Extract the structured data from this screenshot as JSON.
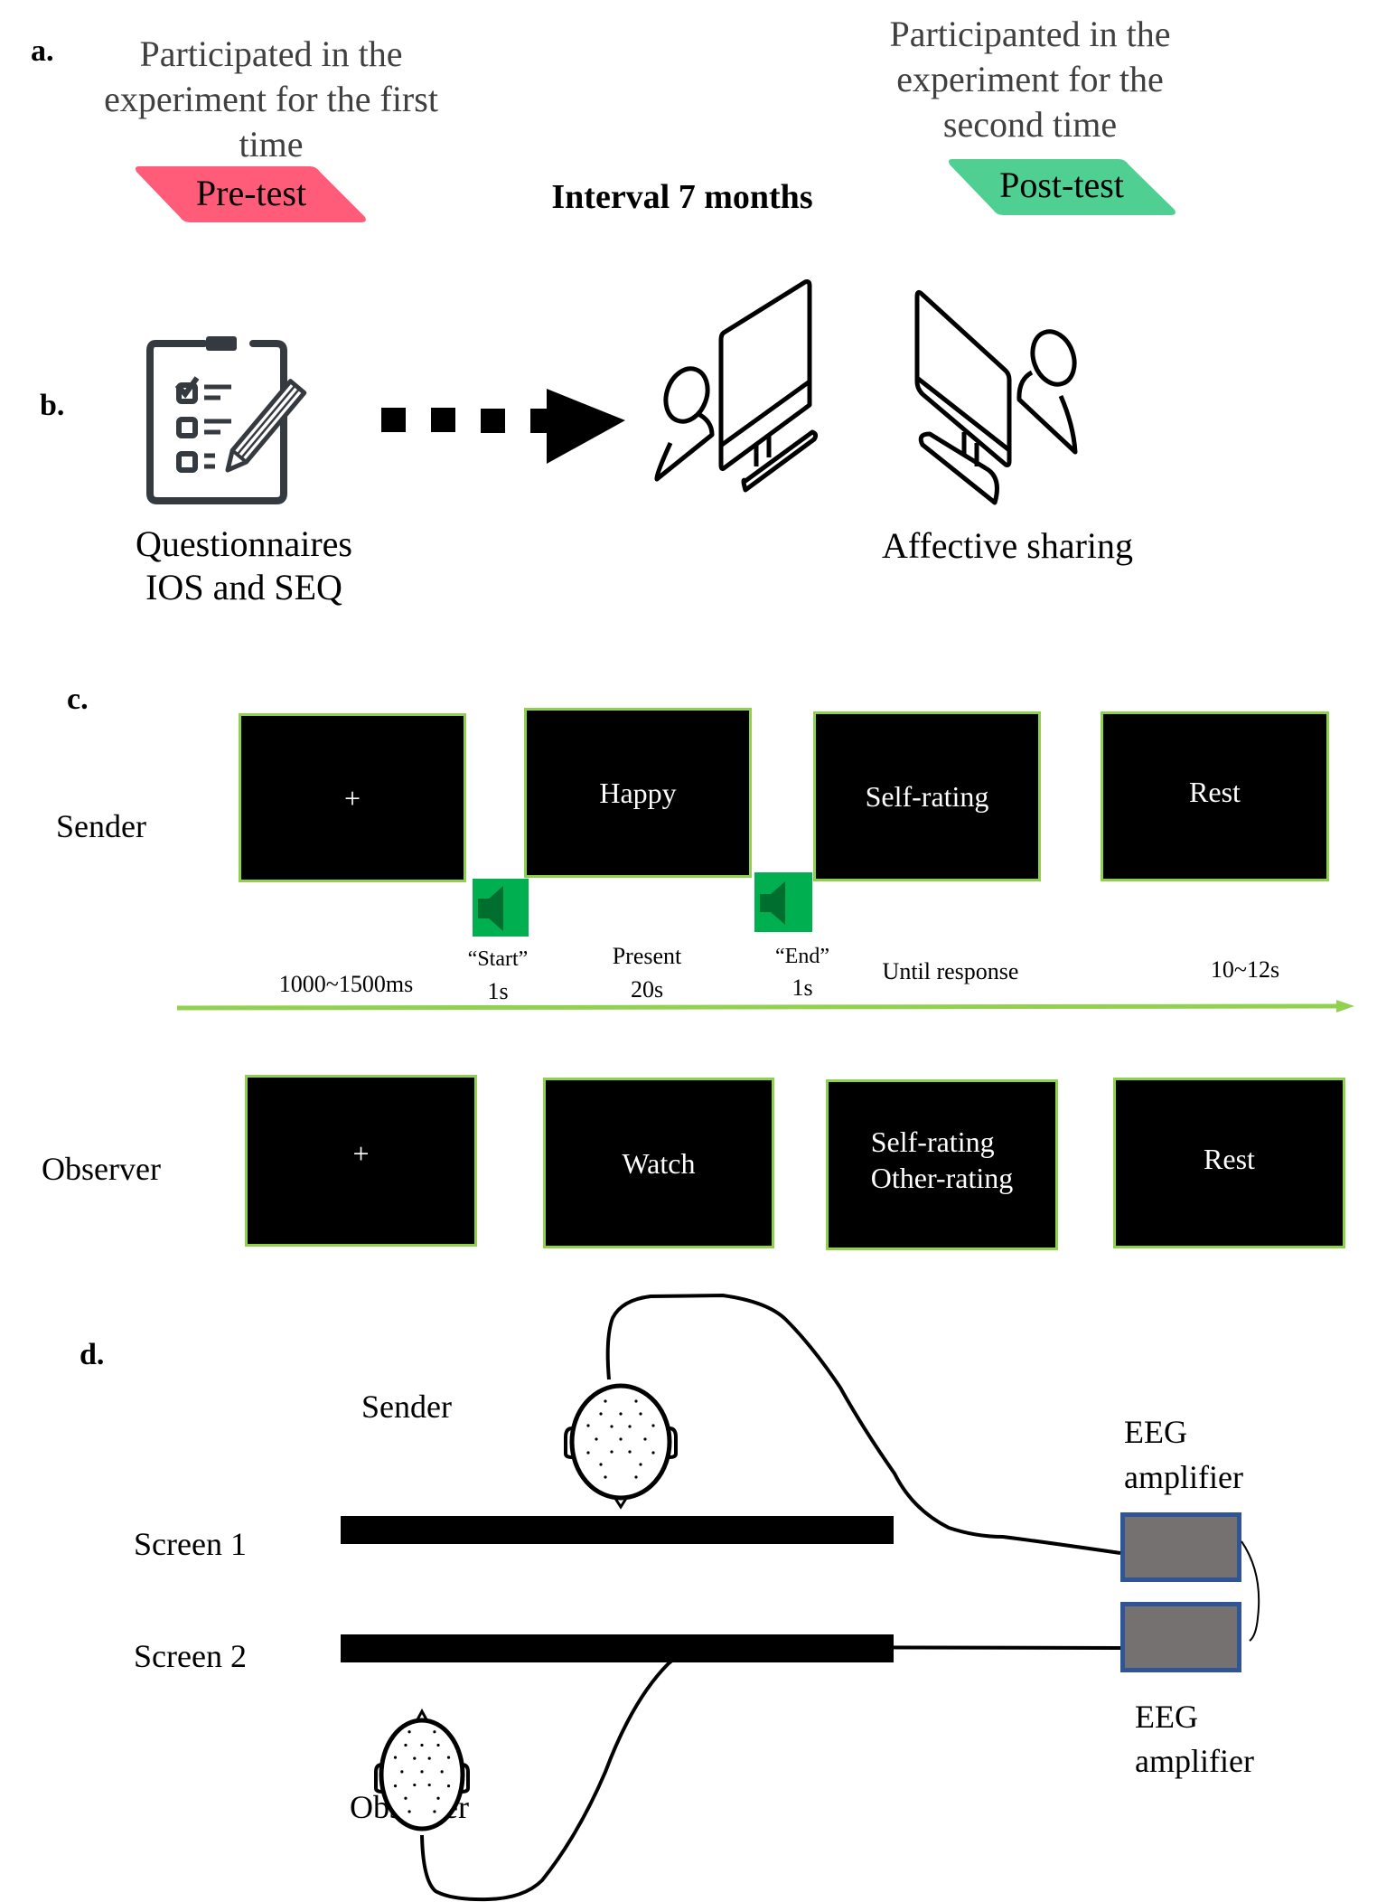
{
  "panel_a": {
    "label": "a.",
    "pretest_description": "Participated in  the\nexperiment for the first\ntime",
    "pretest_tag": "Pre-test",
    "pretest_color": "#FF5C7A",
    "interval": "Interval 7 months",
    "posttest_description": "Participanted  in the\nexperiment for the\nsecond time",
    "posttest_tag": "Post-test",
    "posttest_color": "#4FD092"
  },
  "panel_b": {
    "label": "b.",
    "questionnaire_caption_line1": "Questionnaires",
    "questionnaire_caption_line2": "IOS and SEQ",
    "affective_caption": "Affective sharing",
    "icons": [
      "clipboard-checklist-icon",
      "dashed-arrow-icon",
      "person-icon",
      "monitor-icon",
      "monitor-icon",
      "person-icon"
    ]
  },
  "panel_c": {
    "label": "c.",
    "sender_label": "Sender",
    "observer_label": "Observer",
    "screen_border_color": "#8FD14F",
    "timeline_color": "#92D050",
    "speaker_color": "#00B050",
    "sender_screens": [
      "+",
      "Happy",
      "Self-rating",
      "Rest"
    ],
    "observer_screens": [
      "+",
      "Watch",
      "Self-rating\nOther-rating",
      "Rest"
    ],
    "timeline": {
      "fixation": "1000~1500ms",
      "start_cue": "“Start”",
      "start_duration": "1s",
      "present": "Present",
      "present_duration": "20s",
      "end_cue": "“End”",
      "end_duration": "1s",
      "rating": "Until response",
      "rest": "10~12s"
    }
  },
  "panel_d": {
    "label": "d.",
    "sender_label": "Sender",
    "observer_label": "Observer",
    "screen1_label": "Screen 1",
    "screen2_label": "Screen 2",
    "amp1_label_line1": "EEG",
    "amp1_label_line2": "amplifier",
    "amp2_label_line1": "EEG",
    "amp2_label_line2": "amplifier",
    "amp_fill_color": "#767171",
    "amp_border_color": "#2F5597"
  }
}
